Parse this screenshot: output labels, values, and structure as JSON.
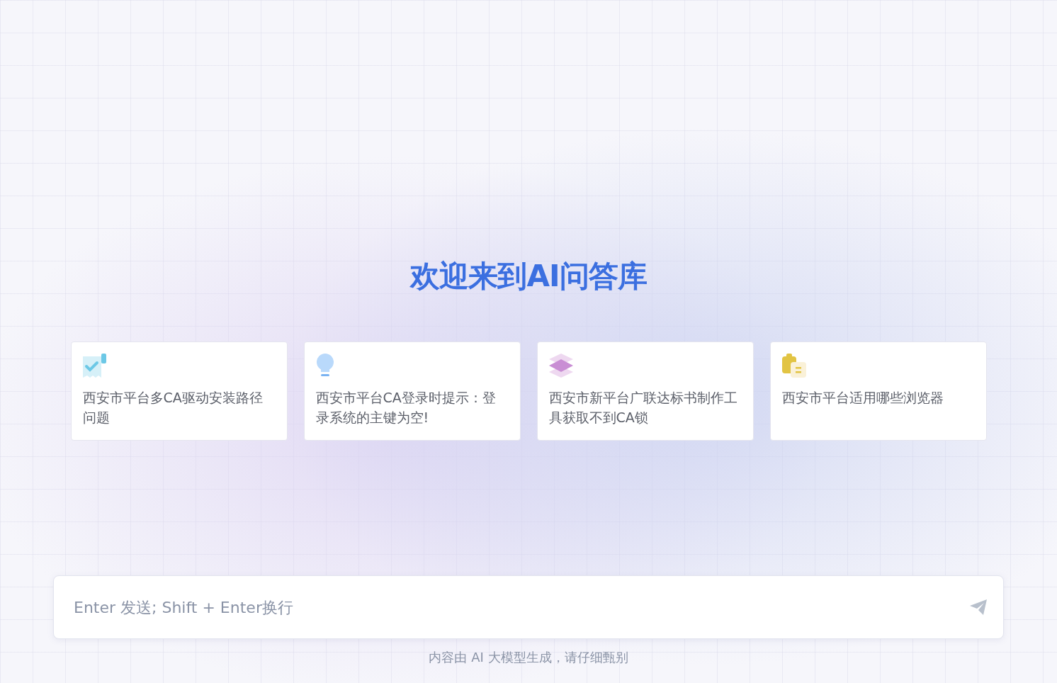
{
  "title": "欢迎来到AI问答库",
  "suggestions": [
    {
      "kind": "receipt",
      "text": "西安市平台多CA驱动安装路径问题"
    },
    {
      "kind": "bulb",
      "text": "西安市平台CA登录时提示：登录系统的主键为空!"
    },
    {
      "kind": "layers",
      "text": "西安市新平台广联达标书制作工具获取不到CA锁"
    },
    {
      "kind": "clipboard",
      "text": "西安市平台适用哪些浏览器"
    }
  ],
  "input": {
    "placeholder": "Enter 发送; Shift + Enter换行"
  },
  "footer": "内容由 AI 大模型生成，请仔细甄别"
}
